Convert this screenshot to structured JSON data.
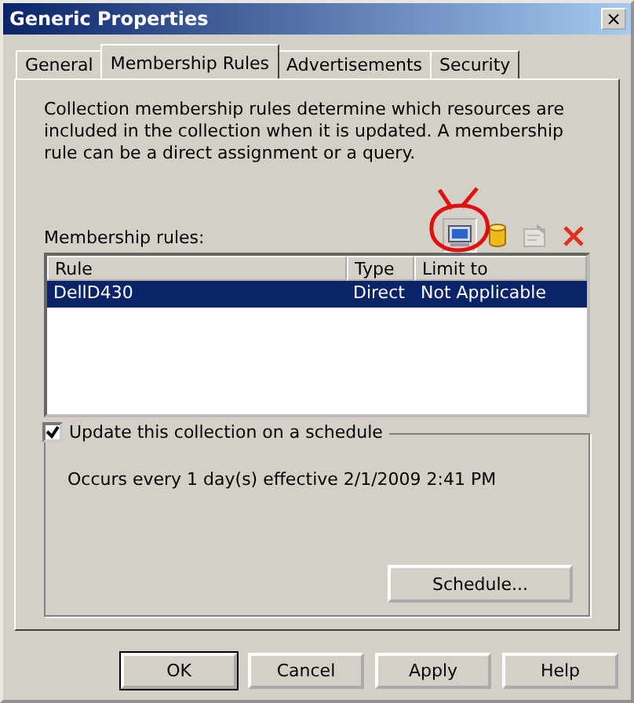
{
  "window": {
    "title": "Generic Properties",
    "close": "×"
  },
  "tabs": [
    {
      "label": "General",
      "selected": false
    },
    {
      "label": "Membership Rules",
      "selected": true
    },
    {
      "label": "Advertisements",
      "selected": false
    },
    {
      "label": "Security",
      "selected": false
    }
  ],
  "description": "Collection membership rules determine which resources are included in the collection when it is updated. A membership rule can be a direct assignment or a query.",
  "rules": {
    "label": "Membership rules:",
    "toolbar": [
      {
        "kind": "computer",
        "disabled": false
      },
      {
        "kind": "query",
        "disabled": false
      },
      {
        "kind": "properties",
        "disabled": true
      },
      {
        "kind": "delete",
        "disabled": false
      }
    ],
    "columns": [
      "Rule",
      "Type",
      "Limit to"
    ],
    "rows": [
      {
        "cells": [
          "DellD430",
          "Direct",
          "Not Applicable"
        ],
        "selected": true
      }
    ]
  },
  "schedule": {
    "label": "Update this collection on a schedule",
    "checked": true,
    "summary": "Occurs every 1 day(s) effective 2/1/2009 2:41 PM",
    "button": "Schedule..."
  },
  "buttons": [
    "OK",
    "Cancel",
    "Apply",
    "Help"
  ]
}
